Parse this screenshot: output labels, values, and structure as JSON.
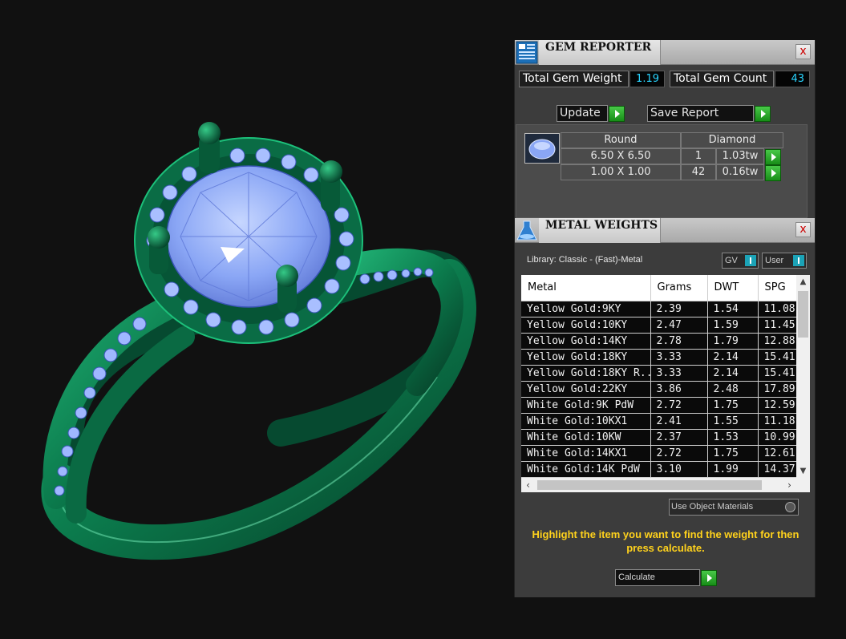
{
  "gem_reporter": {
    "title": "GEM REPORTER",
    "close": "x",
    "total_gem_weight_label": "Total Gem Weight",
    "total_gem_weight_value": "1.19",
    "total_gem_count_label": "Total Gem Count",
    "total_gem_count_value": "43",
    "update_label": "Update",
    "save_report_label": "Save Report",
    "shape": "Round",
    "material": "Diamond",
    "rows": [
      {
        "size": "6.50 X 6.50",
        "count": "1",
        "weight": "1.03tw"
      },
      {
        "size": "1.00 X 1.00",
        "count": "42",
        "weight": "0.16tw"
      }
    ],
    "colors": {
      "value": "#29d4ff",
      "button": "#2eaa2e"
    }
  },
  "metal_weights": {
    "title": "METAL WEIGHTS",
    "close": "x",
    "library": "Library: Classic - (Fast)-Metal",
    "gv_label": "GV",
    "user_label": "User",
    "columns": [
      "Metal",
      "Grams",
      "DWT",
      "SPG"
    ],
    "rows": [
      [
        "Yellow Gold:9KY",
        "2.39",
        "1.54",
        "11.08"
      ],
      [
        "Yellow Gold:10KY",
        "2.47",
        "1.59",
        "11.45"
      ],
      [
        "Yellow Gold:14KY",
        "2.78",
        "1.79",
        "12.88"
      ],
      [
        "Yellow Gold:18KY",
        "3.33",
        "2.14",
        "15.41"
      ],
      [
        "Yellow Gold:18KY R...",
        "3.33",
        "2.14",
        "15.41"
      ],
      [
        "Yellow Gold:22KY",
        "3.86",
        "2.48",
        "17.89"
      ],
      [
        "White Gold:9K PdW",
        "2.72",
        "1.75",
        "12.59"
      ],
      [
        "White Gold:10KX1",
        "2.41",
        "1.55",
        "11.18"
      ],
      [
        "White Gold:10KW",
        "2.37",
        "1.53",
        "10.99"
      ],
      [
        "White Gold:14KX1",
        "2.72",
        "1.75",
        "12.61"
      ],
      [
        "White Gold:14K PdW",
        "3.10",
        "1.99",
        "14.37"
      ]
    ],
    "use_object_materials": "Use Object Materials",
    "hint": "Highlight the item you want to find the weight for then press calculate.",
    "calculate_label": "Calculate",
    "colors": {
      "hint": "#ffd21c",
      "toggle": "#1ba3b7"
    }
  },
  "viewport": {
    "colors": {
      "metal": "#0f8a5a",
      "gem": "#8fb0ff",
      "background": "#111111"
    }
  }
}
